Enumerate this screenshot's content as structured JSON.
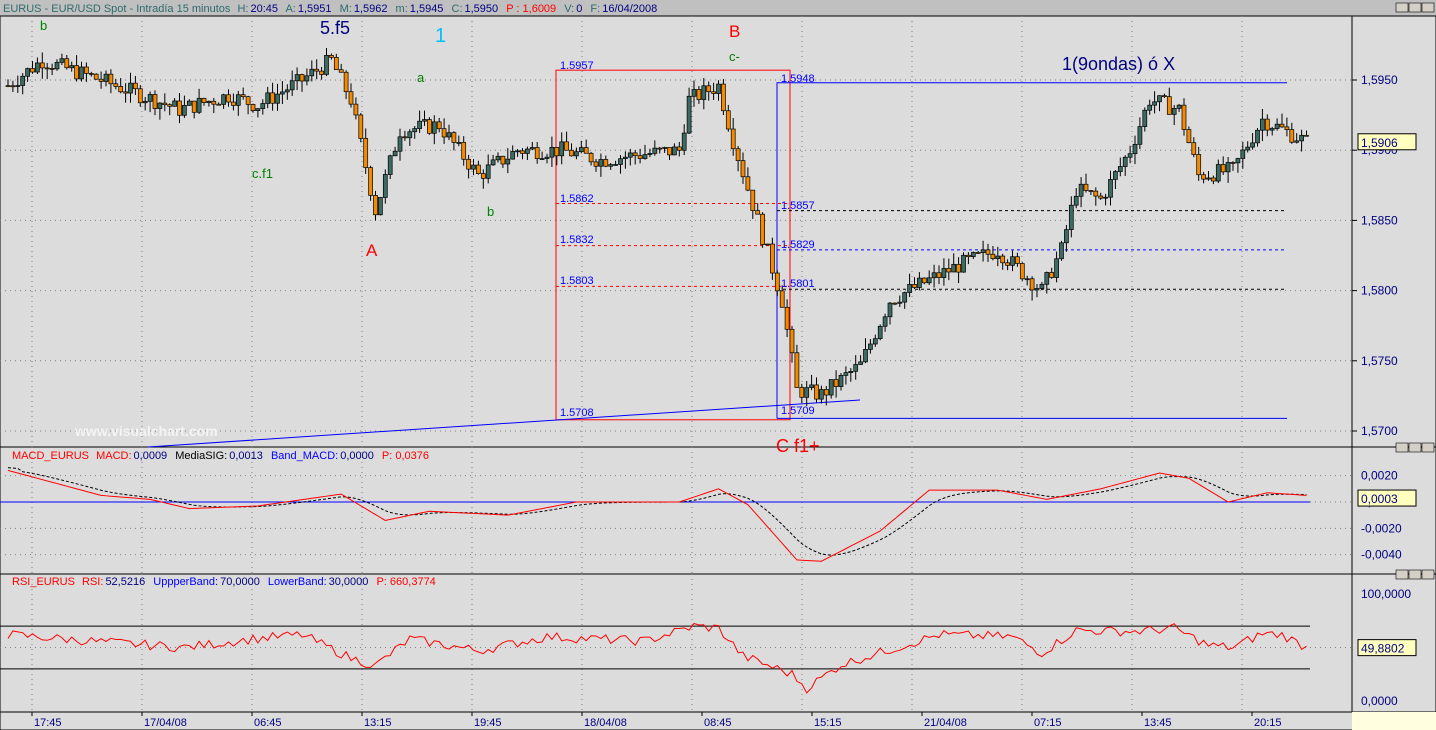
{
  "header": {
    "symbol": "EURUS - EUR/USD Spot - Intradía 15 minutos",
    "h_label": "H:",
    "h": "20:45",
    "a_label": "A:",
    "a": "1,5951",
    "m_label": "M:",
    "m": "1,5962",
    "mi_label": "m:",
    "mi": "1,5945",
    "c_label": "C:",
    "c": "1,5950",
    "p": "P : 1,6009",
    "v_label": "V:",
    "v": "0",
    "f_label": "F:",
    "f": "16/04/2008"
  },
  "macd_header": {
    "name": "MACD_EURUS",
    "macd_label": "MACD:",
    "macd": "0,0009",
    "sig_label": "MediaSIG:",
    "sig": "0,0013",
    "band_label": "Band_MACD:",
    "band": "0,0000",
    "p": "P: 0,0376"
  },
  "rsi_header": {
    "name": "RSI_EURUS",
    "rsi_label": "RSI:",
    "rsi": "52,5216",
    "up_label": "UppperBand:",
    "up": "70,0000",
    "low_label": "LowerBand:",
    "low": "30,0000",
    "p": "P: 660,3774"
  },
  "colors": {
    "up": "#3c6b63",
    "down": "#f58a00",
    "fib_red": "#ff0000",
    "fib_blue": "#0000ff",
    "macd": "#ff0000",
    "signal": "#000000"
  },
  "watermark": "www.visualchart.com",
  "annotations": [
    {
      "text": "b",
      "color": "#008000"
    },
    {
      "text": "5.f5",
      "color": "#000080"
    },
    {
      "text": "1",
      "color": "#00c0ff"
    },
    {
      "text": "a",
      "color": "#008000"
    },
    {
      "text": "c.f1",
      "color": "#008000"
    },
    {
      "text": "A",
      "color": "#ff0000"
    },
    {
      "text": "b",
      "color": "#008000"
    },
    {
      "text": "B",
      "color": "#ff0000"
    },
    {
      "text": "c-",
      "color": "#008000"
    },
    {
      "text": "1(9ondas) ó X",
      "color": "#000080"
    },
    {
      "text": "C f1+",
      "color": "#ff0000"
    }
  ],
  "fib_labels": {
    "red": [
      "1.5957",
      "1.5862",
      "1.5832",
      "1.5803",
      "1.5708"
    ],
    "blue": [
      "1.5948",
      "1.5857",
      "1.5829",
      "1.5801",
      "1.5709"
    ]
  },
  "chart_data": [
    {
      "type": "candlestick",
      "title": "EURUS - EUR/USD Spot - Intradía 15 minutos",
      "ylim": [
        1.5685,
        1.5985
      ],
      "yticks": [
        "1,5700",
        "1,5750",
        "1,5800",
        "1,5850",
        "1,5900",
        "1,5950"
      ],
      "ytick_values": [
        1.57,
        1.575,
        1.58,
        1.585,
        1.59,
        1.595
      ],
      "last_value": "1,5906",
      "xticks": [
        "17:45",
        "17/04/08",
        "06:45",
        "13:15",
        "19:45",
        "18/04/08",
        "08:45",
        "15:15",
        "21/04/08",
        "07:15",
        "13:45",
        "20:15"
      ],
      "close_keypoints": [
        [
          0,
          1.5946
        ],
        [
          7,
          1.5964
        ],
        [
          19,
          1.595
        ],
        [
          35,
          1.5929
        ],
        [
          45,
          1.5939
        ],
        [
          51,
          1.5932
        ],
        [
          60,
          1.595
        ],
        [
          66,
          1.5964
        ],
        [
          70,
          1.5936
        ],
        [
          75,
          1.5857
        ],
        [
          80,
          1.5914
        ],
        [
          88,
          1.5918
        ],
        [
          96,
          1.5882
        ],
        [
          104,
          1.59
        ],
        [
          113,
          1.59
        ],
        [
          121,
          1.5893
        ],
        [
          129,
          1.5897
        ],
        [
          137,
          1.59
        ],
        [
          139,
          1.5936
        ],
        [
          145,
          1.5946
        ],
        [
          148,
          1.5907
        ],
        [
          153,
          1.585
        ],
        [
          158,
          1.5793
        ],
        [
          161,
          1.5729
        ],
        [
          166,
          1.5726
        ],
        [
          174,
          1.5747
        ],
        [
          180,
          1.5793
        ],
        [
          186,
          1.5804
        ],
        [
          194,
          1.5818
        ],
        [
          202,
          1.5829
        ],
        [
          211,
          1.58
        ],
        [
          215,
          1.5829
        ],
        [
          218,
          1.5872
        ],
        [
          223,
          1.5865
        ],
        [
          229,
          1.59
        ],
        [
          233,
          1.5936
        ],
        [
          239,
          1.5929
        ],
        [
          243,
          1.5882
        ],
        [
          250,
          1.5886
        ],
        [
          256,
          1.5922
        ],
        [
          265,
          1.5906
        ]
      ],
      "fib_red": {
        "high": 1.5957,
        "low": 1.5708,
        "levels": [
          1.5862,
          1.5832,
          1.5803
        ]
      },
      "fib_blue": {
        "high": 1.5948,
        "low": 1.5709,
        "levels": [
          1.5857,
          1.5829,
          1.5801
        ]
      }
    },
    {
      "type": "line",
      "title": "MACD_EURUS",
      "ylim": [
        -0.0055,
        0.0035
      ],
      "yticks": [
        "0,0020",
        "0,0000",
        "-0,0020",
        "-0,0040"
      ],
      "ytick_values": [
        0.002,
        0,
        -0.002,
        -0.004
      ],
      "last_value": "0,0003",
      "macd_keypoints": [
        [
          0,
          0.0024
        ],
        [
          19,
          0.0005
        ],
        [
          29,
          0.0002
        ],
        [
          37,
          -0.0005
        ],
        [
          51,
          -0.0003
        ],
        [
          68,
          0.0006
        ],
        [
          77,
          -0.0014
        ],
        [
          86,
          -0.0007
        ],
        [
          102,
          -0.001
        ],
        [
          116,
          0
        ],
        [
          137,
          0
        ],
        [
          145,
          0.001
        ],
        [
          151,
          -0.0002
        ],
        [
          161,
          -0.0044
        ],
        [
          166,
          -0.0045
        ],
        [
          178,
          -0.0022
        ],
        [
          188,
          0.0009
        ],
        [
          202,
          0.0009
        ],
        [
          212,
          0.0002
        ],
        [
          223,
          0.001
        ],
        [
          235,
          0.0022
        ],
        [
          241,
          0.0018
        ],
        [
          249,
          0
        ],
        [
          257,
          0.0007
        ],
        [
          265,
          0.0005
        ]
      ]
    },
    {
      "type": "line",
      "title": "RSI_EURUS",
      "ylim": [
        -5,
        105
      ],
      "yticks": [
        "100,0000",
        "0,0000"
      ],
      "ytick_values": [
        100,
        0
      ],
      "bands": [
        70,
        30
      ],
      "last_value": "49,8802",
      "rsi_keypoints": [
        [
          0,
          62
        ],
        [
          20,
          55
        ],
        [
          36,
          50
        ],
        [
          50,
          58
        ],
        [
          60,
          62
        ],
        [
          70,
          40
        ],
        [
          75,
          33
        ],
        [
          82,
          58
        ],
        [
          96,
          47
        ],
        [
          110,
          60
        ],
        [
          130,
          56
        ],
        [
          140,
          70
        ],
        [
          145,
          68
        ],
        [
          150,
          42
        ],
        [
          160,
          25
        ],
        [
          163,
          12
        ],
        [
          170,
          34
        ],
        [
          180,
          48
        ],
        [
          190,
          62
        ],
        [
          205,
          60
        ],
        [
          211,
          45
        ],
        [
          218,
          66
        ],
        [
          230,
          65
        ],
        [
          238,
          68
        ],
        [
          245,
          52
        ],
        [
          250,
          50
        ],
        [
          256,
          63
        ],
        [
          260,
          62
        ],
        [
          265,
          50
        ]
      ]
    }
  ]
}
